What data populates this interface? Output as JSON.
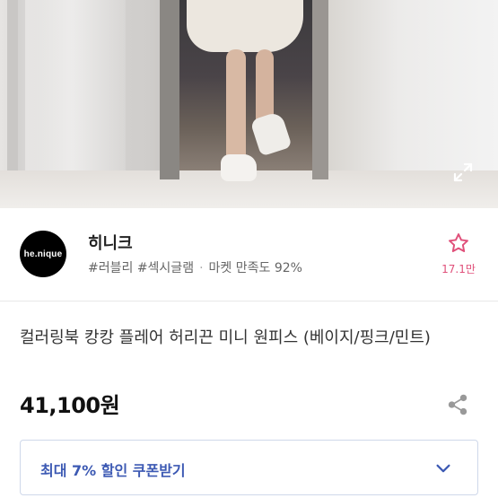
{
  "seller": {
    "avatar_text": "he.nique",
    "name": "히니크",
    "tags": "#러블리 #섹시글램",
    "satisfaction": "마켓 만족도 92%",
    "favorite_count": "17.1만"
  },
  "product": {
    "title": "컬러링북 캉캉 플레어 허리끈 미니 원피스 (베이지/핑크/민트)",
    "price": "41,100원"
  },
  "coupon": {
    "label": "최대 7% 할인 쿠폰받기"
  },
  "colors": {
    "accent_pink": "#e0507a",
    "coupon_blue": "#3c59b3"
  },
  "icons": {
    "expand": "expand-icon",
    "favorite": "star-outline-icon",
    "share": "share-icon",
    "chevron": "chevron-down-icon"
  }
}
